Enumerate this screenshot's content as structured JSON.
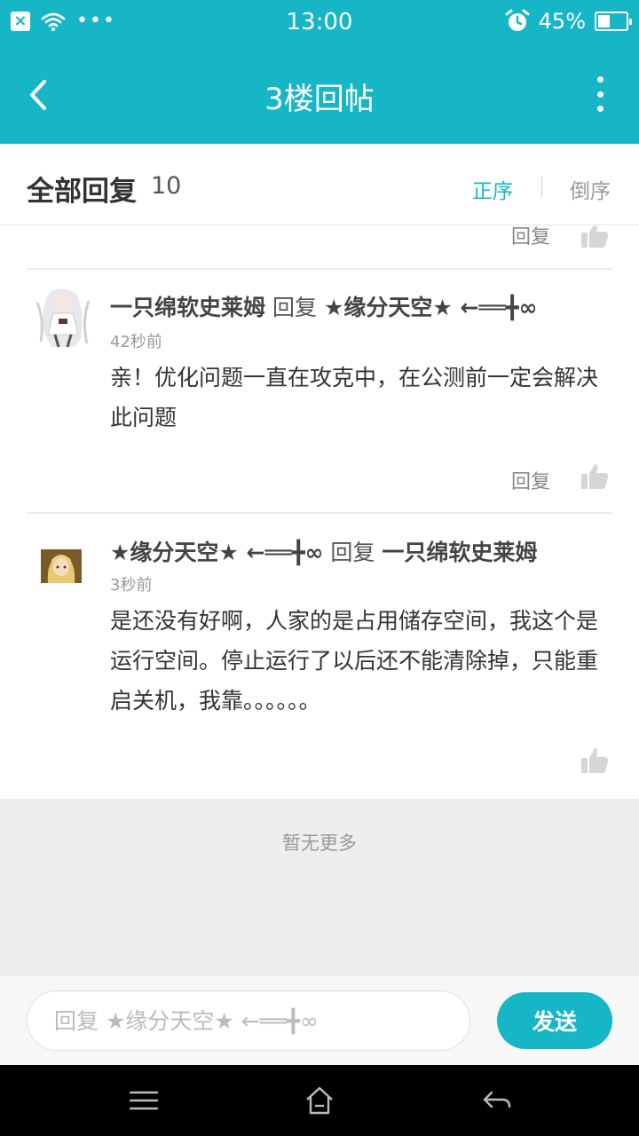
{
  "status_bar": {
    "time": "13:00",
    "battery": "45%",
    "battery_level": 0.45,
    "dots": "•••",
    "icons": [
      "close-box-icon",
      "wifi-icon",
      "more-dots-icon",
      "alarm-icon",
      "battery-icon"
    ]
  },
  "title_bar": {
    "title": "3楼回帖",
    "icons": [
      "back-arrow-icon",
      "more-vertical-icon"
    ]
  },
  "reply_header": {
    "title": "全部回复",
    "count": "10",
    "sort_asc": "正序",
    "sort_desc": "倒序"
  },
  "replies": [
    {
      "partial": true,
      "reply_label": "回复"
    },
    {
      "author": "一只绵软史莱姆",
      "reply_word": "回复",
      "target": "★缘分天空★ ←══╋∞",
      "time": "42秒前",
      "text": "亲！优化问题一直在攻克中，在公测前一定会解决此问题",
      "reply_label": "回复"
    },
    {
      "author": "★缘分天空★ ←══╋∞",
      "reply_word": "回复",
      "target": "一只绵软史莱姆",
      "time": "3秒前",
      "text": "是还没有好啊，人家的是占用储存空间，我这个是运行空间。停止运行了以后还不能清除掉，只能重启关机，我靠。。。。。。"
    }
  ],
  "no_more": "暂无更多",
  "input_bar": {
    "placeholder": "回复 ★缘分天空★ ←══╋∞",
    "send_label": "发送"
  },
  "nav_bar": {
    "icons": [
      "menu-icon",
      "home-icon",
      "back-icon"
    ]
  },
  "colors": {
    "accent": "#17b6c6",
    "background_gray": "#eeeeee"
  }
}
